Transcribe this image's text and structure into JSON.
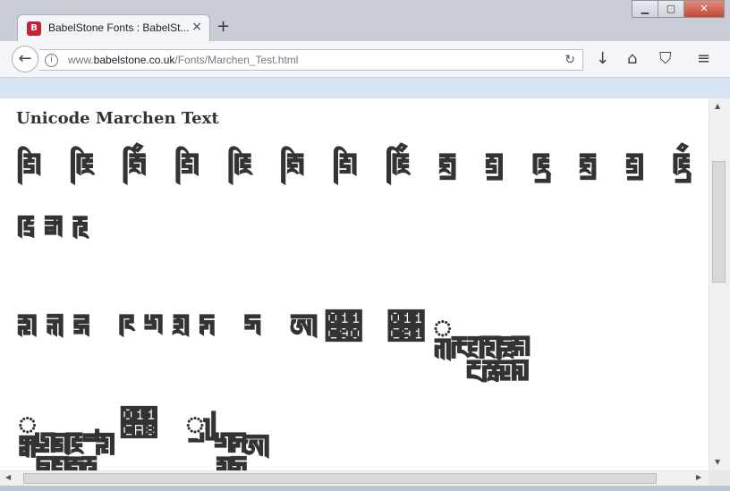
{
  "tab": {
    "title": "BabelStone Fonts : BabelSt...",
    "close": "×",
    "favicon": "B"
  },
  "newtab": "+",
  "window": {
    "minimize": "▁",
    "maximize": "▢",
    "close": "✕"
  },
  "nav": {
    "back": "←",
    "info": "i",
    "url_prefix": "www.",
    "url_domain": "babelstone.co.uk",
    "url_path": "/Fonts/Marchen_Test.html",
    "reload": "↻"
  },
  "toolbar": {
    "download": "↓",
    "home": "⌂",
    "pocket": "⛉",
    "menu": "≡"
  },
  "page": {
    "heading": "Unicode Marchen Text",
    "lines": [
      "𑲁𑲱 𑲂𑲱 𑲃𑲱𑲵 𑲁𑲱 𑲂𑲱 𑲃𑲱 𑲁𑲱 𑲂𑲱𑲵 𑲃𑲲 𑲁𑲲 𑲂𑲲 𑲃𑲲 𑲁𑲲 𑲂𑲲𑲵",
      "𑲄𑲅𑲆",
      "𑲇𑲈𑲉 𑲊𑲋𑲌𑲍 𑲎 𑲏𑲐 𑲑𑲒 𑲓 𑲔𑲕 𑲖𑲗 𑲘𑲙 𑲚𑲛",
      "𑲜𑲝 𑲞𑲟 𑲠𑲡 𑲢𑲣𑲤 𑲥𑲦 𑲧𑲨 𑲩𑲪 𑲫𑲬 𑲭𑲮 𑲯"
    ]
  },
  "scroll": {
    "up": "▲",
    "down": "▼",
    "left": "◀",
    "right": "▶",
    "grip": "|||"
  }
}
